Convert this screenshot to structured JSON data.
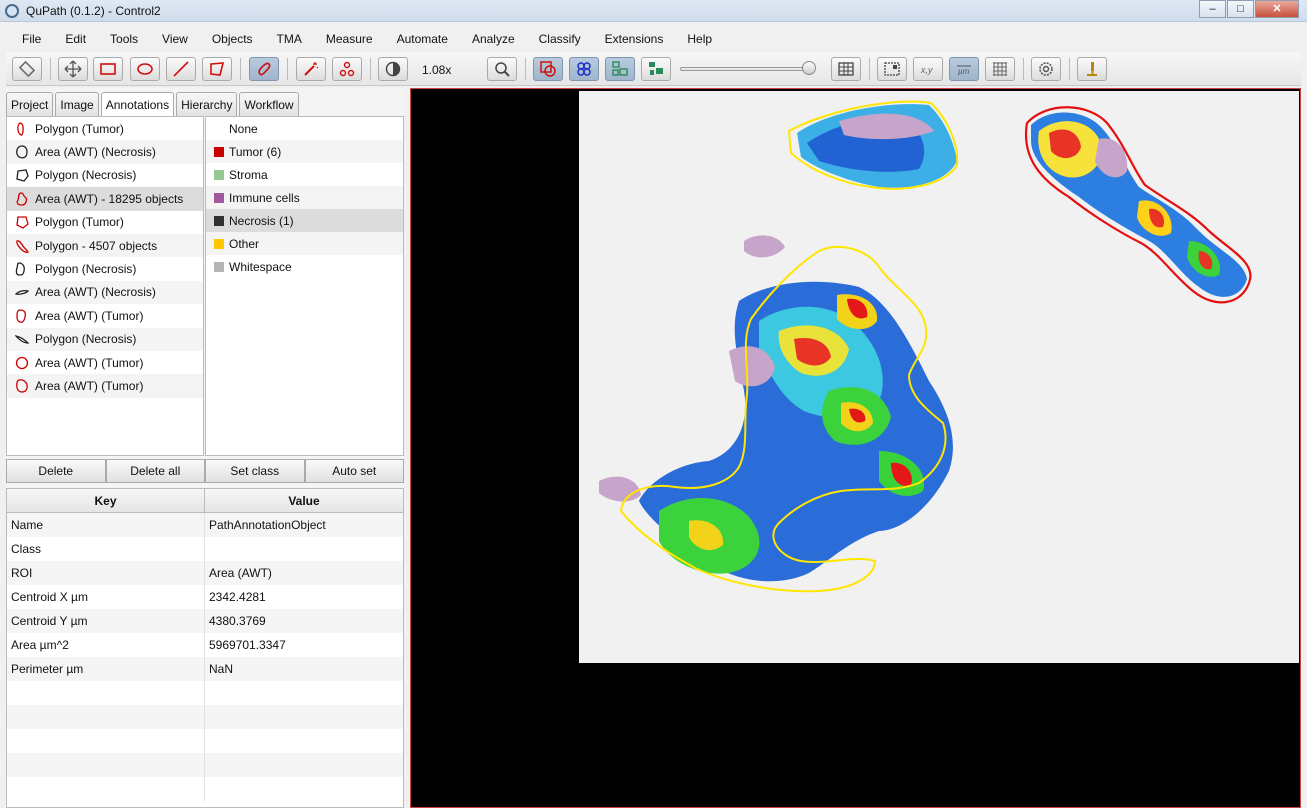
{
  "window": {
    "title": "QuPath (0.1.2) - Control2",
    "controls": [
      "minimize",
      "maximize",
      "close"
    ]
  },
  "menu": [
    "File",
    "Edit",
    "Tools",
    "View",
    "Objects",
    "TMA",
    "Measure",
    "Automate",
    "Analyze",
    "Classify",
    "Extensions",
    "Help"
  ],
  "toolbar": {
    "zoom_label": "1.08x",
    "icons": [
      "measurement-panel-icon",
      "move-icon",
      "rectangle-icon",
      "ellipse-icon",
      "line-icon",
      "polygon-icon",
      "brush-icon",
      "wand-icon",
      "points-icon",
      "brightness-contrast-icon",
      "zoom-to-fit-icon",
      "show-annotations-icon",
      "show-tma-grid-icon",
      "show-detections-icon",
      "fill-detections-icon",
      "overview-icon",
      "location-icon",
      "scalebar-icon",
      "grid-icon",
      "preferences-icon",
      "log-icon"
    ]
  },
  "tabs": [
    "Project",
    "Image",
    "Annotations",
    "Hierarchy",
    "Workflow"
  ],
  "annotations": [
    {
      "label": "Polygon (Tumor)",
      "icon": "tumor-polygon-icon",
      "color": "#cc0000"
    },
    {
      "label": "Area (AWT) (Necrosis)",
      "icon": "necrosis-area-icon",
      "color": "#222222"
    },
    {
      "label": "Polygon (Necrosis)",
      "icon": "necrosis-polygon-icon",
      "color": "#222222"
    },
    {
      "label": "Area (AWT) - 18295 objects",
      "icon": "unclassified-area-icon",
      "color": "#cc0000"
    },
    {
      "label": "Polygon (Tumor)",
      "icon": "tumor-polygon-icon",
      "color": "#cc0000"
    },
    {
      "label": "Polygon - 4507 objects",
      "icon": "unclassified-polygon-icon",
      "color": "#cc0000"
    },
    {
      "label": "Polygon (Necrosis)",
      "icon": "necrosis-polygon-icon",
      "color": "#222222"
    },
    {
      "label": "Area (AWT) (Necrosis)",
      "icon": "necrosis-area-icon",
      "color": "#222222"
    },
    {
      "label": "Area (AWT) (Tumor)",
      "icon": "tumor-area-icon",
      "color": "#cc0000"
    },
    {
      "label": "Polygon (Necrosis)",
      "icon": "necrosis-polygon-icon",
      "color": "#222222"
    },
    {
      "label": "Area (AWT) (Tumor)",
      "icon": "tumor-area-icon",
      "color": "#cc0000"
    },
    {
      "label": "Area (AWT) (Tumor)",
      "icon": "tumor-area-icon",
      "color": "#cc0000"
    }
  ],
  "classes": [
    {
      "label": "None",
      "color": ""
    },
    {
      "label": "Tumor (6)",
      "color": "#c80000"
    },
    {
      "label": "Stroma",
      "color": "#96c896"
    },
    {
      "label": "Immune cells",
      "color": "#a05a9b"
    },
    {
      "label": "Necrosis (1)",
      "color": "#323232"
    },
    {
      "label": "Other",
      "color": "#ffc800"
    },
    {
      "label": "Whitespace",
      "color": "#b4b4b4"
    }
  ],
  "buttons": {
    "delete": "Delete",
    "delete_all": "Delete all",
    "set_class": "Set class",
    "auto_set": "Auto set"
  },
  "measurements": {
    "key_header": "Key",
    "value_header": "Value",
    "rows": [
      {
        "key": "Name",
        "value": "PathAnnotationObject"
      },
      {
        "key": "Class",
        "value": ""
      },
      {
        "key": "ROI",
        "value": "Area (AWT)"
      },
      {
        "key": "Centroid X µm",
        "value": "2342.4281"
      },
      {
        "key": "Centroid Y µm",
        "value": "4380.3769"
      },
      {
        "key": "Area µm^2",
        "value": "5969701.3347"
      },
      {
        "key": "Perimeter µm",
        "value": "NaN"
      }
    ]
  }
}
